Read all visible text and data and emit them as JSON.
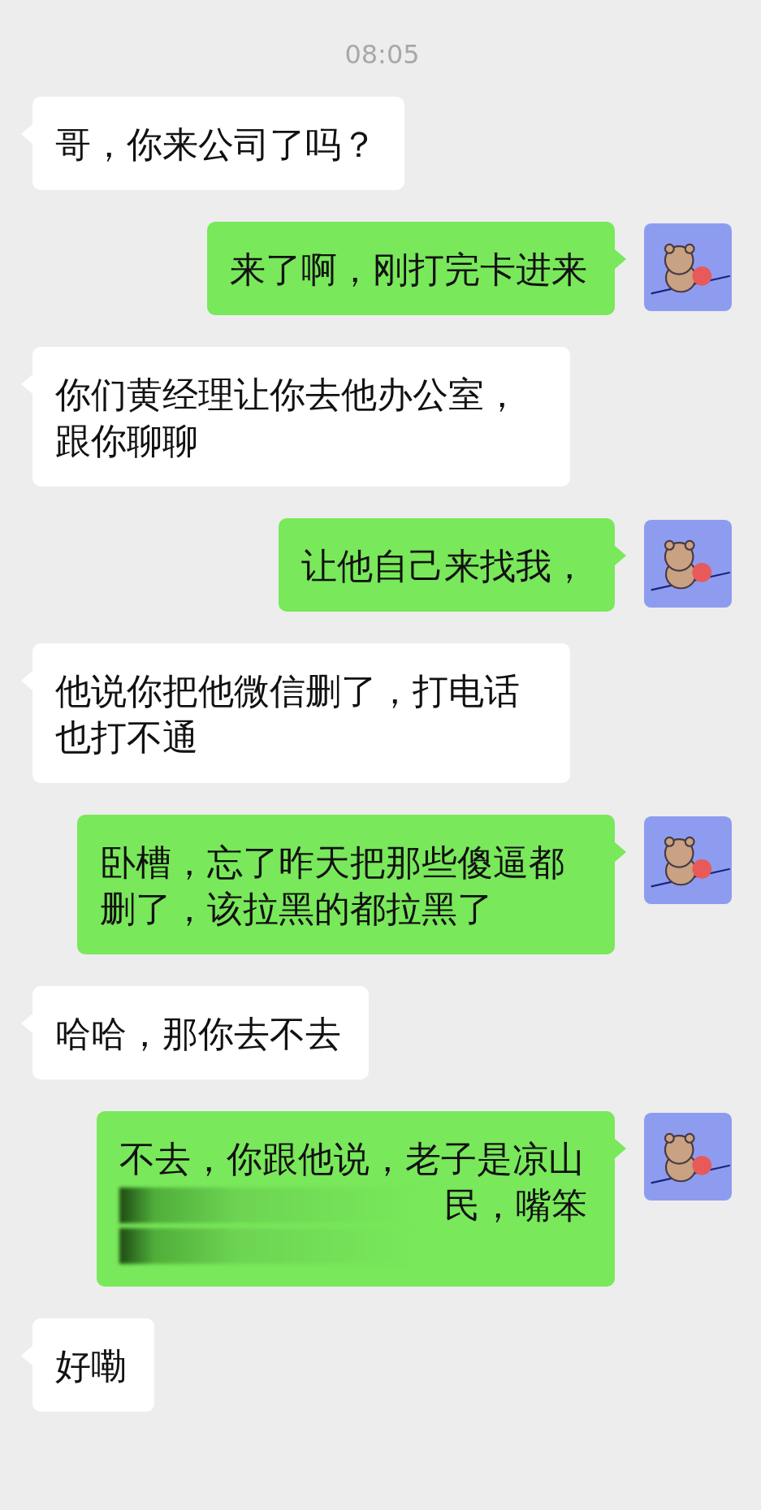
{
  "time": "08:05",
  "messages": [
    {
      "kind": "received",
      "lines": [
        [
          {
            "kind": "text",
            "text": "哥，你来公司了吗？"
          }
        ]
      ]
    },
    {
      "kind": "sent",
      "lines": [
        [
          {
            "kind": "text",
            "text": "来了啊，刚打完卡进来"
          }
        ]
      ]
    },
    {
      "kind": "received",
      "lines": [
        [
          {
            "kind": "text",
            "text": "你们黄经理让你去他办公室，跟你聊聊"
          }
        ]
      ]
    },
    {
      "kind": "sent",
      "lines": [
        [
          {
            "kind": "text",
            "text": "让他自己来找我，"
          }
        ]
      ]
    },
    {
      "kind": "received",
      "lines": [
        [
          {
            "kind": "text",
            "text": "他说你把他微信删了，打电话也打不通"
          }
        ]
      ]
    },
    {
      "kind": "sent",
      "lines": [
        [
          {
            "kind": "text",
            "text": "卧槽，忘了昨天把那些傻逼都删了，该拉黑的都拉黑了"
          }
        ]
      ]
    },
    {
      "kind": "received",
      "lines": [
        [
          {
            "kind": "text",
            "text": "哈哈，那你去不去"
          }
        ]
      ]
    },
    {
      "kind": "sent",
      "lines": [
        [
          {
            "kind": "text",
            "text": "不去，你跟他说，老子是凉山"
          }
        ],
        [
          {
            "kind": "redacted"
          },
          {
            "kind": "text",
            "text": "民，嘴笨"
          }
        ],
        [
          {
            "kind": "redacted"
          }
        ]
      ]
    },
    {
      "kind": "received",
      "lines": [
        [
          {
            "kind": "text",
            "text": "好嘞"
          }
        ]
      ]
    }
  ]
}
